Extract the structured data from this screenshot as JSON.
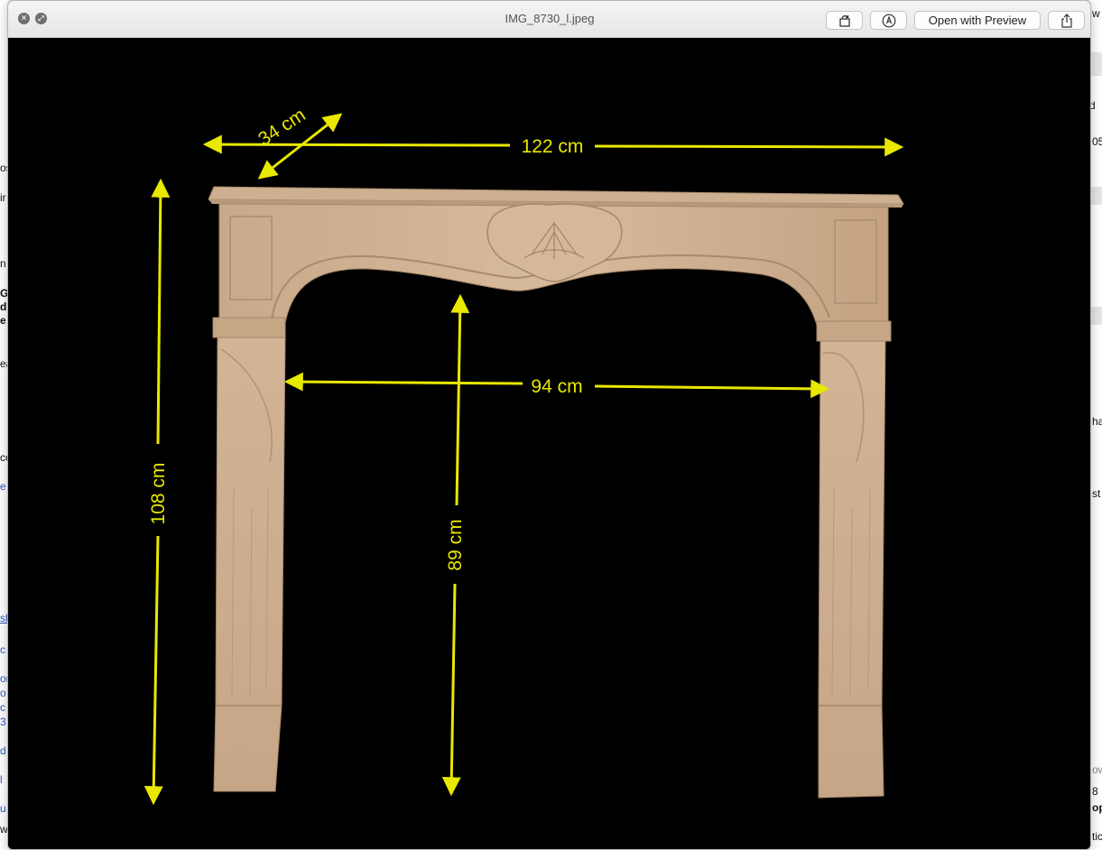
{
  "window": {
    "title": "IMG_8730_l.jpeg",
    "open_with_label": "Open with Preview"
  },
  "photo": {
    "dimensions": {
      "depth": "34 cm",
      "width": "122 cm",
      "height": "108 cm",
      "opening_width": "94 cm",
      "opening_height": "89 cm"
    }
  },
  "background_left_fragments": [
    "os",
    "ir",
    "n",
    "G",
    "d",
    "e",
    "ea",
    "co",
    "e",
    "sl",
    "c",
    "or",
    "o",
    "c",
    "3",
    "d",
    "l",
    "u",
    "w"
  ],
  "background_right_fragments": [
    "w",
    "d",
    "05",
    "ha",
    "st",
    "ow",
    "8",
    "op",
    "tic"
  ],
  "colors": {
    "annotation": "#e8e800",
    "titlebar": "#ececec",
    "link": "#2a56c6"
  }
}
